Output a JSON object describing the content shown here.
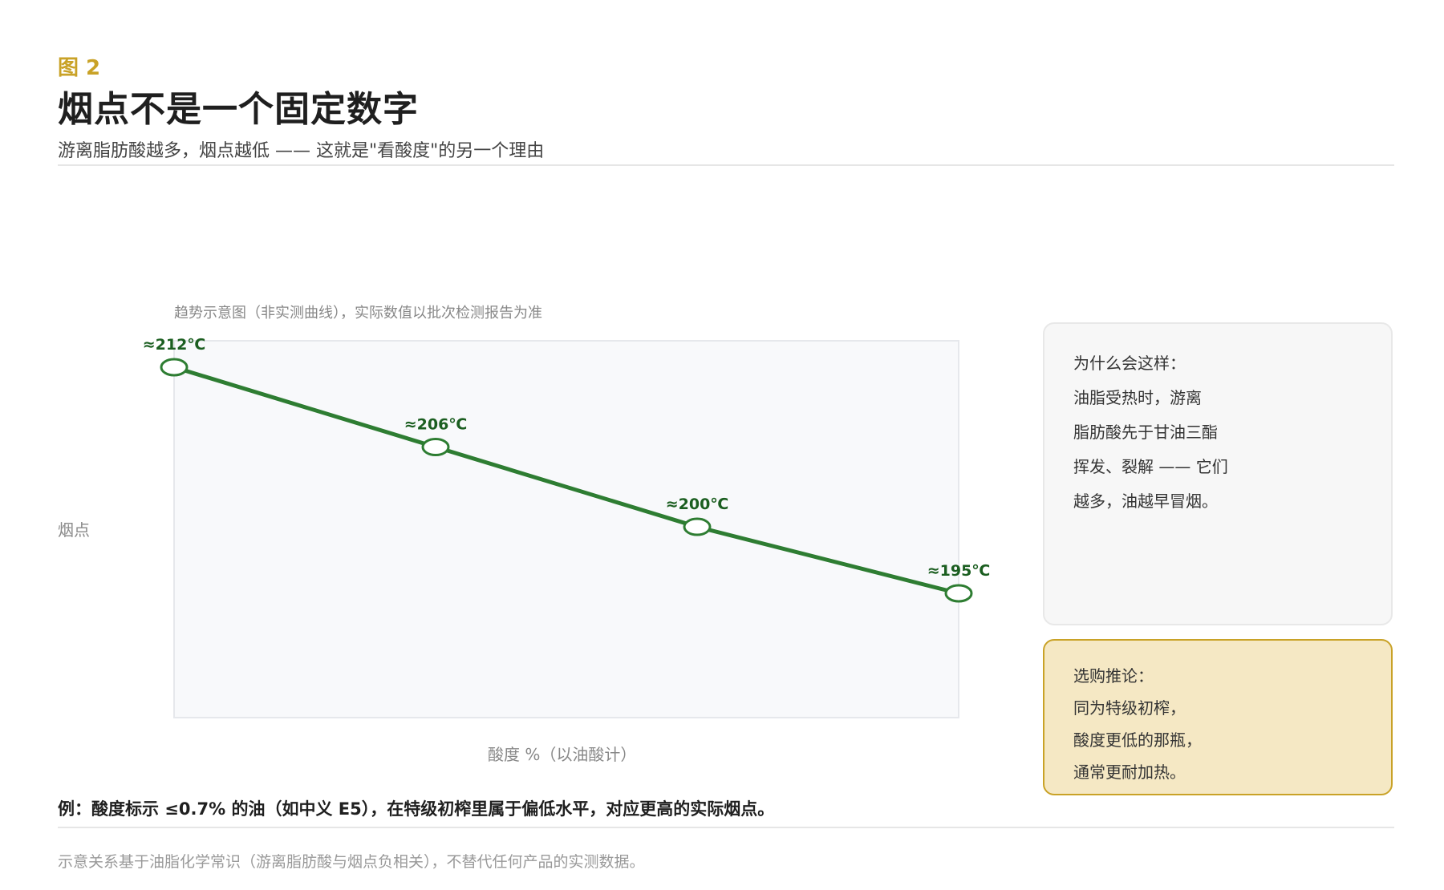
{
  "header": {
    "figure_label": "图 2",
    "title": "烟点不是一个固定数字",
    "subtitle": "游离脂肪酸越多，烟点越低 —— 这就是\"看酸度\"的另一个理由"
  },
  "chart_note": "趋势示意图（非实测曲线），实际数值以批次检测报告为准",
  "chart_data": {
    "type": "line",
    "xlabel": "酸度 %（以油酸计）",
    "ylabel": "烟点",
    "series": [
      {
        "values": [
          212,
          206,
          200,
          195
        ],
        "labels": [
          "≈212℃",
          "≈206℃",
          "≈200℃",
          "≈195℃"
        ]
      }
    ],
    "grid": false,
    "colors": {
      "line": "#2e7d32",
      "label": "#1b5e20",
      "plot_bg": "#f8f9fb",
      "plot_border": "#e6e8ec"
    }
  },
  "why_box": {
    "lines": [
      "为什么会这样：",
      "油脂受热时，游离",
      "脂肪酸先于甘油三酯",
      "挥发、裂解 —— 它们",
      "越多，油越早冒烟。"
    ]
  },
  "buy_box": {
    "lines": [
      "选购推论：",
      "同为特级初榨，",
      "酸度更低的那瓶，",
      "通常更耐加热。"
    ]
  },
  "example": "例：酸度标示 ≤0.7% 的油（如中义 E5），在特级初榨里属于偏低水平，对应更高的实际烟点。",
  "footnote": "示意关系基于油脂化学常识（游离脂肪酸与烟点负相关），不替代任何产品的实测数据。",
  "colors": {
    "accent": "#c9a227",
    "line": "#2e7d32",
    "buy_box_bg": "#f5e8c4"
  }
}
